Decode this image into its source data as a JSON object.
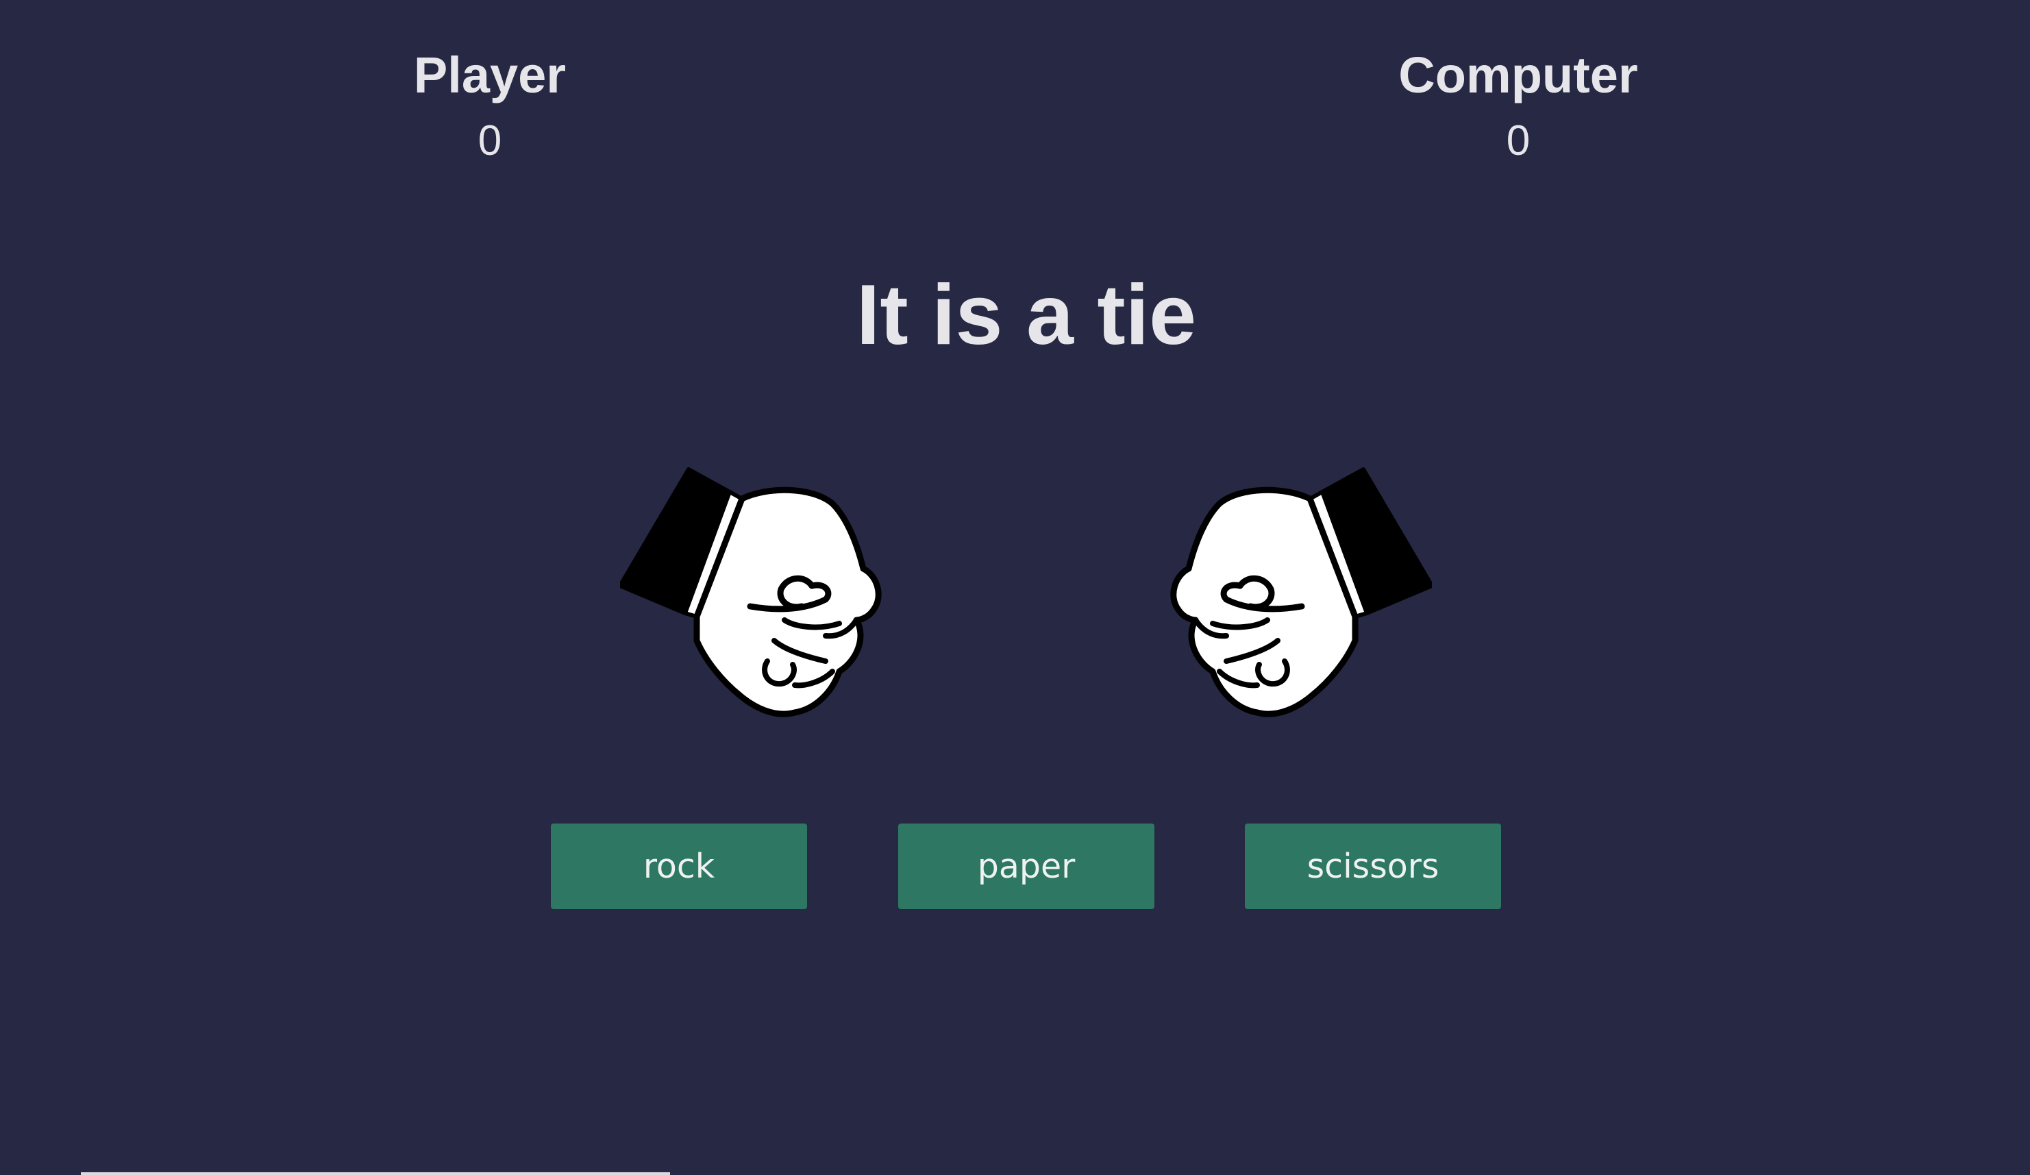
{
  "scoreboard": {
    "player": {
      "label": "Player",
      "score": "0"
    },
    "computer": {
      "label": "Computer",
      "score": "0"
    }
  },
  "result": {
    "message": "It is a tie"
  },
  "hands": {
    "player": {
      "choice": "rock",
      "icon": "rock-fist-icon"
    },
    "computer": {
      "choice": "rock",
      "icon": "rock-fist-icon"
    }
  },
  "buttons": {
    "rock": "rock",
    "paper": "paper",
    "scissors": "scissors"
  },
  "colors": {
    "background": "#262844",
    "button": "#2e7763",
    "text": "#e6e6ea"
  }
}
